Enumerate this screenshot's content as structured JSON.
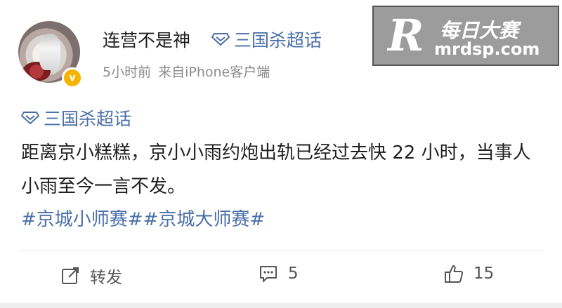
{
  "post": {
    "username": "连营不是神",
    "topic_tag": "三国杀超话",
    "time": "5小时前",
    "source": "来自iPhone客户端",
    "body_tag": "三国杀超话",
    "text": "距离京小糕糕，京小小雨约炮出轨已经过去快 22 小时，当事人小雨至今一言不发。",
    "hashtags": "#京城小师赛##京城大师赛#",
    "verified_badge": "v"
  },
  "actions": {
    "repost_label": "转发",
    "comment_count": "5",
    "like_count": "15"
  },
  "watermark": {
    "logo": "R",
    "name": "每日大赛",
    "url": "mrdsp.com"
  },
  "colors": {
    "link": "#4a6fa8",
    "verified": "#f5b400"
  }
}
